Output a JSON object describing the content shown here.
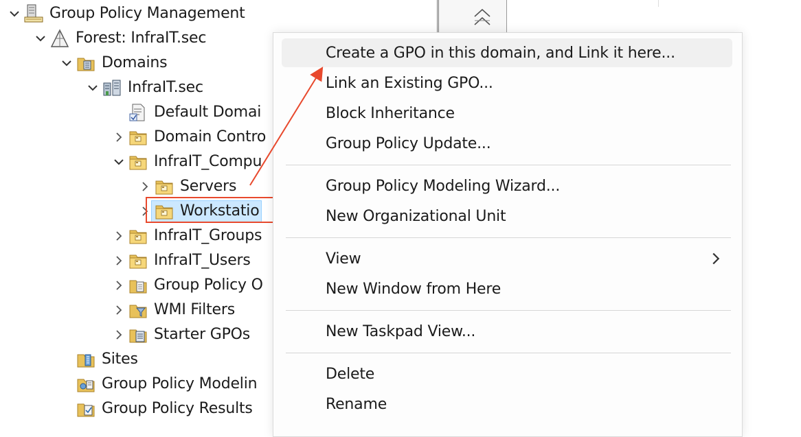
{
  "tree": {
    "root": "Group Policy Management",
    "forest": "Forest: InfraIT.sec",
    "domains": "Domains",
    "domain": "InfraIT.sec",
    "default_policy": "Default Domai",
    "domain_controllers": "Domain Contro",
    "computers_ou": "InfraIT_Compu",
    "servers": "Servers",
    "workstations": "Workstatio",
    "groups": "InfraIT_Groups",
    "users": "InfraIT_Users",
    "gpo_objects": "Group Policy O",
    "wmi_filters": "WMI Filters",
    "starter_gpos": "Starter GPOs",
    "sites": "Sites",
    "modeling": "Group Policy Modelin",
    "results": "Group Policy Results"
  },
  "context_menu": {
    "create_gpo": "Create a GPO in this domain, and Link it here...",
    "link_existing": "Link an Existing GPO...",
    "block_inheritance": "Block Inheritance",
    "gp_update": "Group Policy Update...",
    "modeling_wizard": "Group Policy Modeling Wizard...",
    "new_ou": "New Organizational Unit",
    "view": "View",
    "new_window": "New Window from Here",
    "new_taskpad": "New Taskpad View...",
    "delete": "Delete",
    "rename": "Rename"
  },
  "annotation": {
    "highlight_color": "#e8492d"
  },
  "icons": {
    "root": "gpm-console-icon",
    "forest": "forest-icon",
    "domains": "domains-folder-icon",
    "domain": "domain-icon",
    "gpo_link": "gpo-link-icon",
    "ou": "ou-folder-icon",
    "gpo_container": "gpo-container-icon",
    "wmi": "wmi-filter-icon",
    "starter": "starter-gpo-icon",
    "sites": "sites-icon",
    "modeling": "modeling-icon",
    "results": "results-icon"
  }
}
